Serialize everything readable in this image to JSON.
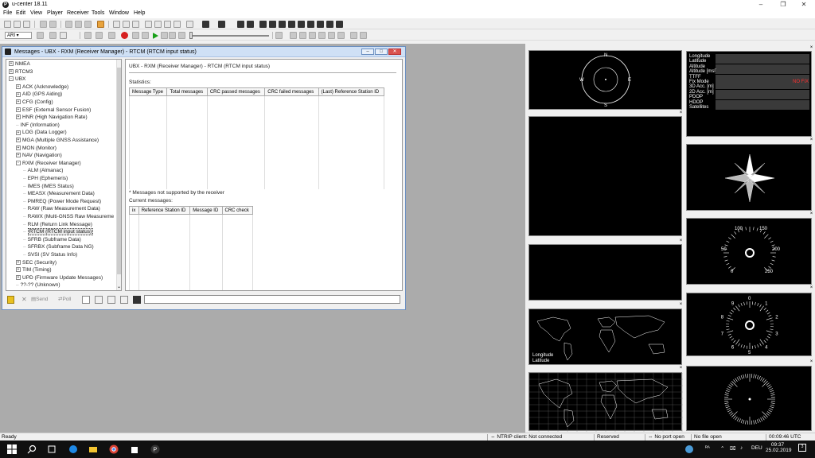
{
  "window": {
    "title": "u-center 18.11",
    "controls": [
      "–",
      "❐",
      "✕"
    ]
  },
  "menu": [
    "File",
    "Edit",
    "View",
    "Player",
    "Receiver",
    "Tools",
    "Window",
    "Help"
  ],
  "toolbar2": {
    "port_select": "ARI"
  },
  "messages_window": {
    "title": "Messages - UBX - RXM (Receiver Manager) - RTCM (RTCM input status)",
    "tree": [
      {
        "label": "NMEA",
        "level": 0,
        "expander": "+"
      },
      {
        "label": "RTCM3",
        "level": 0,
        "expander": "+"
      },
      {
        "label": "UBX",
        "level": 0,
        "expander": "-"
      },
      {
        "label": "ACK (Acknowledge)",
        "level": 1,
        "expander": "+"
      },
      {
        "label": "AID (GPS Aiding)",
        "level": 1,
        "expander": "+"
      },
      {
        "label": "CFG (Config)",
        "level": 1,
        "expander": "+"
      },
      {
        "label": "ESF (External Sensor Fusion)",
        "level": 1,
        "expander": "+"
      },
      {
        "label": "HNR (High Navigation Rate)",
        "level": 1,
        "expander": "+"
      },
      {
        "label": "INF (Information)",
        "level": 1,
        "expander": ""
      },
      {
        "label": "LOG (Data Logger)",
        "level": 1,
        "expander": "+"
      },
      {
        "label": "MGA (Multiple GNSS Assistance)",
        "level": 1,
        "expander": "+"
      },
      {
        "label": "MON (Monitor)",
        "level": 1,
        "expander": "+"
      },
      {
        "label": "NAV (Navigation)",
        "level": 1,
        "expander": "+"
      },
      {
        "label": "RXM (Receiver Manager)",
        "level": 1,
        "expander": "-"
      },
      {
        "label": "ALM (Almanac)",
        "level": 2,
        "expander": ""
      },
      {
        "label": "EPH (Ephemeris)",
        "level": 2,
        "expander": ""
      },
      {
        "label": "IMES (IMES Status)",
        "level": 2,
        "expander": ""
      },
      {
        "label": "MEASX (Measurement Data)",
        "level": 2,
        "expander": ""
      },
      {
        "label": "PMREQ (Power Mode Request)",
        "level": 2,
        "expander": ""
      },
      {
        "label": "RAW (Raw Measurement Data)",
        "level": 2,
        "expander": ""
      },
      {
        "label": "RAWX (Multi-GNSS Raw Measureme",
        "level": 2,
        "expander": ""
      },
      {
        "label": "RLM (Return Link Message)",
        "level": 2,
        "expander": ""
      },
      {
        "label": "RTCM (RTCM input status)",
        "level": 2,
        "expander": "",
        "selected": true
      },
      {
        "label": "SFRB (Subframe Data)",
        "level": 2,
        "expander": ""
      },
      {
        "label": "SFRBX (Subframe Data NG)",
        "level": 2,
        "expander": ""
      },
      {
        "label": "SVSI (SV Status Info)",
        "level": 2,
        "expander": ""
      },
      {
        "label": "SEC (Security)",
        "level": 1,
        "expander": "+"
      },
      {
        "label": "TIM (Timing)",
        "level": 1,
        "expander": "+"
      },
      {
        "label": "UPD (Firmware Update Messages)",
        "level": 1,
        "expander": "+"
      },
      {
        "label": "??-?? (Unknown)",
        "level": 1,
        "expander": ""
      }
    ],
    "panel": {
      "heading": "UBX - RXM (Receiver Manager) - RTCM (RTCM input status)",
      "statistics_label": "Statistics:",
      "stats_columns": [
        "Message Type",
        "Total messages",
        "CRC passed messages",
        "CRC failed messages",
        "(Last) Reference Station ID"
      ],
      "note": "* Messages not supported by the receiver",
      "current_label": "Current messages:",
      "current_columns": [
        "ix",
        "Reference Station ID",
        "Message ID",
        "CRC check"
      ]
    },
    "bottom_toolbar": {
      "send": "Send",
      "poll": "Poll"
    }
  },
  "views": {
    "compass_letters": [
      "N",
      "E",
      "S",
      "W"
    ],
    "data_fields": [
      {
        "label": "Longitude"
      },
      {
        "label": "Latitude"
      },
      {
        "label": "Altitude"
      },
      {
        "label": "Altitude [msl]"
      },
      {
        "label": "TTFF"
      },
      {
        "label": "Fix Mode",
        "value": "NO FIX"
      },
      {
        "label": "3D Acc. [m]"
      },
      {
        "label": "2D Acc. [m]"
      },
      {
        "label": "PDOP"
      },
      {
        "label": "HDOP"
      },
      {
        "label": "Satellites"
      }
    ],
    "map_labels": [
      "Longitude",
      "Latitude"
    ],
    "speed_ticks": [
      "100",
      "150",
      "50",
      "200",
      "0",
      "250"
    ],
    "clock_ticks": [
      "0",
      "1",
      "2",
      "3",
      "4",
      "5",
      "6",
      "7",
      "8",
      "9"
    ]
  },
  "status": {
    "left": "Ready",
    "ntrip": "NTRIP client: Not connected",
    "reserved": "Reserved",
    "port": "No port open",
    "file": "No file open",
    "time": "00:09:46",
    "tz": "UTC"
  },
  "taskbar": {
    "tray_lang": "DEU",
    "tray_ra": "ᴿᴬ",
    "clock_time": "09:37",
    "clock_date": "25.02.2019"
  }
}
